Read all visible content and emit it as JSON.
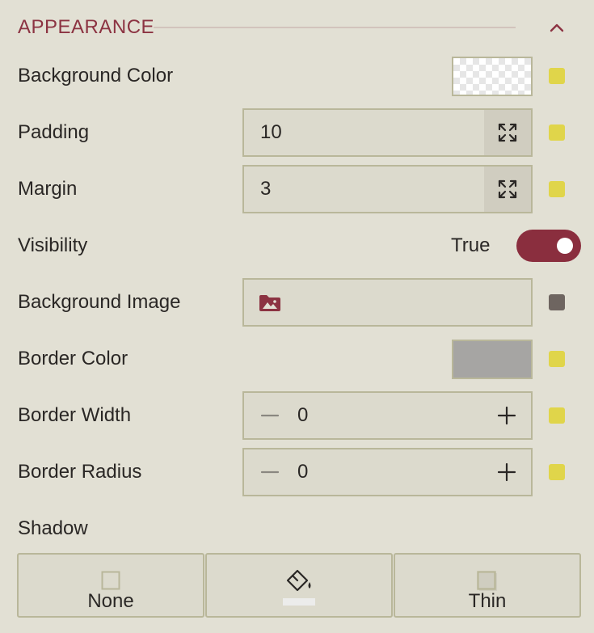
{
  "section": {
    "title": "APPEARANCE",
    "collapse_icon": "chevron-up-icon"
  },
  "colors": {
    "accent": "#8c3342",
    "indicator_set": "#e0d54a",
    "indicator_unset": "#6e6560",
    "panel_bg": "#e2e0d4"
  },
  "rows": {
    "background_color": {
      "label": "Background Color",
      "value": "transparent"
    },
    "padding": {
      "label": "Padding",
      "value": "10"
    },
    "margin": {
      "label": "Margin",
      "value": "3"
    },
    "visibility": {
      "label": "Visibility",
      "value": "True",
      "on": true
    },
    "background_image": {
      "label": "Background Image",
      "icon": "image-folder-icon"
    },
    "border_color": {
      "label": "Border Color",
      "value": "#a6a5a3"
    },
    "border_width": {
      "label": "Border Width",
      "value": "0"
    },
    "border_radius": {
      "label": "Border Radius",
      "value": "0"
    }
  },
  "shadow": {
    "label": "Shadow",
    "options": [
      {
        "label": "None",
        "icon": "square-outline-icon"
      },
      {
        "label": "",
        "icon": "paint-bucket-icon"
      },
      {
        "label": "Thin",
        "icon": "square-thin-shadow-icon"
      }
    ]
  }
}
